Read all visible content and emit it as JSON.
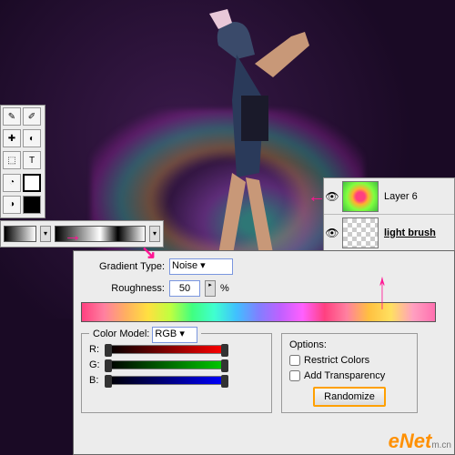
{
  "tools": {
    "items": [
      "✎",
      "✐",
      "✚",
      "◐",
      "⬚",
      "T",
      "◧",
      "◔",
      "▭",
      "◑",
      "⬛",
      "⬜"
    ]
  },
  "gradient_row": {
    "dropdown": "▾"
  },
  "layers": {
    "rows": [
      {
        "eye": "👁",
        "name": "Layer 6",
        "bold": false
      },
      {
        "eye": "👁",
        "name": "light brush",
        "bold": true
      }
    ]
  },
  "dialog": {
    "gradient_type_label": "Gradient Type:",
    "gradient_type_value": "Noise",
    "roughness_label": "Roughness:",
    "roughness_value": "50",
    "percent": "%",
    "color_model_label": "Color Model:",
    "color_model_value": "RGB",
    "channels": {
      "r": "R:",
      "g": "G:",
      "b": "B:"
    },
    "options_label": "Options:",
    "restrict_label": "Restrict Colors",
    "transparency_label": "Add Transparency",
    "randomize_label": "Randomize"
  },
  "watermark": {
    "main": "eNet",
    "sub": "m.cn"
  },
  "arrows": {
    "a1": "→",
    "a2": "↘",
    "a3": "←",
    "a4": "↑"
  }
}
